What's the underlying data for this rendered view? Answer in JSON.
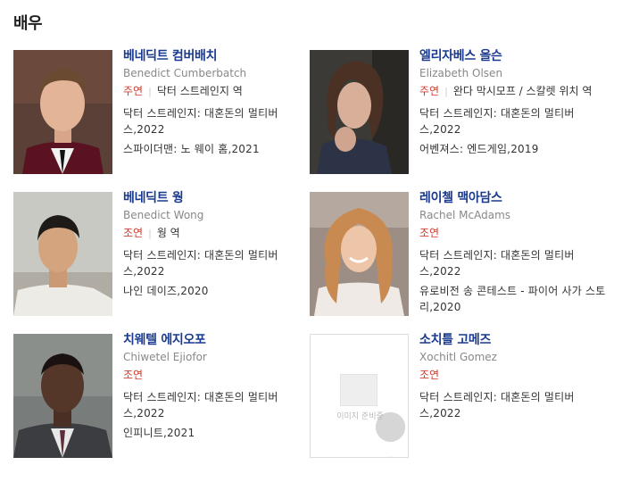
{
  "section": {
    "title": "배우"
  },
  "actors": [
    {
      "name": "베네딕트 컴버배치",
      "name_en": "Benedict Cumberbatch",
      "role_type": "주연",
      "role": "닥터 스트레인지 역",
      "works": [
        "닥터 스트레인지: 대혼돈의 멀티버스,2022",
        "스파이더맨: 노 웨이 홈,2021"
      ]
    },
    {
      "name": "엘리자베스 올슨",
      "name_en": "Elizabeth Olsen",
      "role_type": "주연",
      "role": "완다 막시모프 / 스칼렛 위치 역",
      "works": [
        "닥터 스트레인지: 대혼돈의 멀티버스,2022",
        "어벤져스: 엔드게임,2019"
      ]
    },
    {
      "name": "베네딕트 웡",
      "name_en": "Benedict Wong",
      "role_type": "조연",
      "role": "웡 역",
      "works": [
        "닥터 스트레인지: 대혼돈의 멀티버스,2022",
        "나인 데이즈,2020"
      ]
    },
    {
      "name": "레이첼 맥아담스",
      "name_en": "Rachel McAdams",
      "role_type": "조연",
      "role": "",
      "works": [
        "닥터 스트레인지: 대혼돈의 멀티버스,2022",
        "유로비전 송 콘테스트 - 파이어 사가 스토리,2020"
      ]
    },
    {
      "name": "치웨텔 에지오포",
      "name_en": "Chiwetel Ejiofor",
      "role_type": "조연",
      "role": "",
      "works": [
        "닥터 스트레인지: 대혼돈의 멀티버스,2022",
        "인피니트,2021"
      ]
    },
    {
      "name": "소치틀 고메즈",
      "name_en": "Xochitl Gomez",
      "role_type": "조연",
      "role": "",
      "no_image_text": "이미지 준비중",
      "works": [
        "닥터 스트레인지: 대혼돈의 멀티버스,2022"
      ]
    }
  ]
}
